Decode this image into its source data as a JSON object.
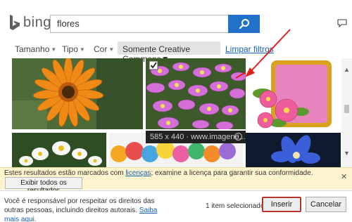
{
  "brand": {
    "name": "bing",
    "accent": "#2271c8"
  },
  "search": {
    "query": "flores"
  },
  "filters": {
    "items": [
      {
        "label": "Tamanho"
      },
      {
        "label": "Tipo"
      },
      {
        "label": "Cor"
      },
      {
        "label": "Somente Creative Commons"
      }
    ],
    "clear_label": "Limpar filtros"
  },
  "results": {
    "tiles": [
      {
        "icon": "gerbera-flower-image"
      },
      {
        "icon": "pink-daisies-image",
        "selected": true
      },
      {
        "icon": "pink-flowers-card-image"
      },
      {
        "icon": "white-daisies-image"
      },
      {
        "icon": "colorful-flowers-image"
      },
      {
        "icon": "blue-flower-image"
      }
    ],
    "hover_tooltip": "585 x 440 · www.imagene..."
  },
  "notice": {
    "text_before": "Estes resultados estão marcados com ",
    "link": "licenças",
    "text_after": "; examine a licença para garantir sua conformidade.",
    "button": "Exibir todos os resultados",
    "background": "#fff4ce"
  },
  "footer": {
    "disclaimer": "Você é responsável por respeitar os direitos das outras pessoas, incluindo direitos autorais.",
    "learn_more": "Saiba mais aqui.",
    "selected_count": "1 item selecionado.",
    "insert_label": "Inserir",
    "cancel_label": "Cancelar"
  }
}
